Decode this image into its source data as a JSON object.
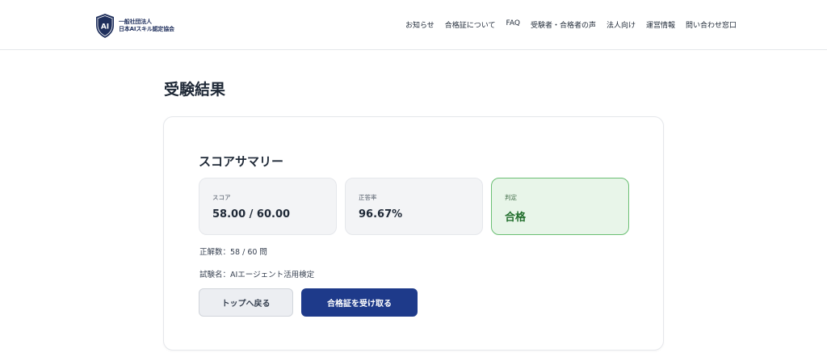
{
  "header": {
    "logo": {
      "mark_text": "AI",
      "line1": "一般社団法人",
      "line2": "日本AIスキル認定協会"
    },
    "nav": [
      "お知らせ",
      "合格証について",
      "FAQ",
      "受験者・合格者の声",
      "法人向け",
      "運営情報",
      "問い合わせ窓口"
    ]
  },
  "page": {
    "title": "受験結果"
  },
  "summary": {
    "title": "スコアサマリー",
    "score": {
      "label": "スコア",
      "value": "58.00 / 60.00"
    },
    "accuracy": {
      "label": "正答率",
      "value": "96.67%"
    },
    "verdict": {
      "label": "判定",
      "value": "合格"
    },
    "correct_count": "正解数：58 / 60 問",
    "exam_name": "試験名：AIエージェント活用検定",
    "buttons": {
      "back": "トップへ戻る",
      "certificate": "合格証を受け取る"
    }
  },
  "colors": {
    "primary": "#1e3a8a",
    "pass_bg": "#e8f5e9",
    "pass_border": "#6abf73",
    "pass_text": "#216e2c"
  }
}
